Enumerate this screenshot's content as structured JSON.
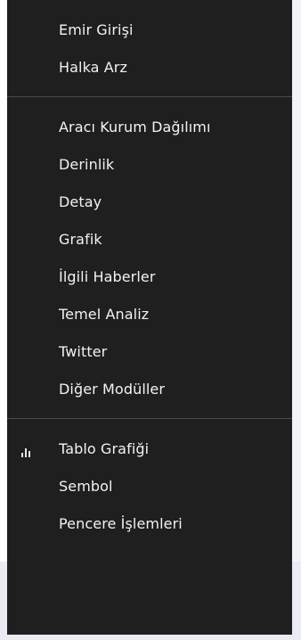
{
  "menu": {
    "section1": [
      {
        "label": "Emir Girişi"
      },
      {
        "label": "Halka Arz"
      }
    ],
    "section2": [
      {
        "label": "Aracı Kurum Dağılımı"
      },
      {
        "label": "Derinlik"
      },
      {
        "label": "Detay"
      },
      {
        "label": "Grafik"
      },
      {
        "label": "İlgili Haberler"
      },
      {
        "label": "Temel Analiz"
      },
      {
        "label": "Twitter"
      },
      {
        "label": "Diğer Modüller"
      }
    ],
    "section3": [
      {
        "label": "Tablo Grafiği",
        "icon": "bar-chart-icon"
      },
      {
        "label": "Sembol"
      },
      {
        "label": "Pencere İşlemleri"
      }
    ]
  },
  "colors": {
    "menu_bg": "#1f1f1f",
    "menu_text": "#f2f2f2",
    "divider": "#4a4a4a"
  }
}
